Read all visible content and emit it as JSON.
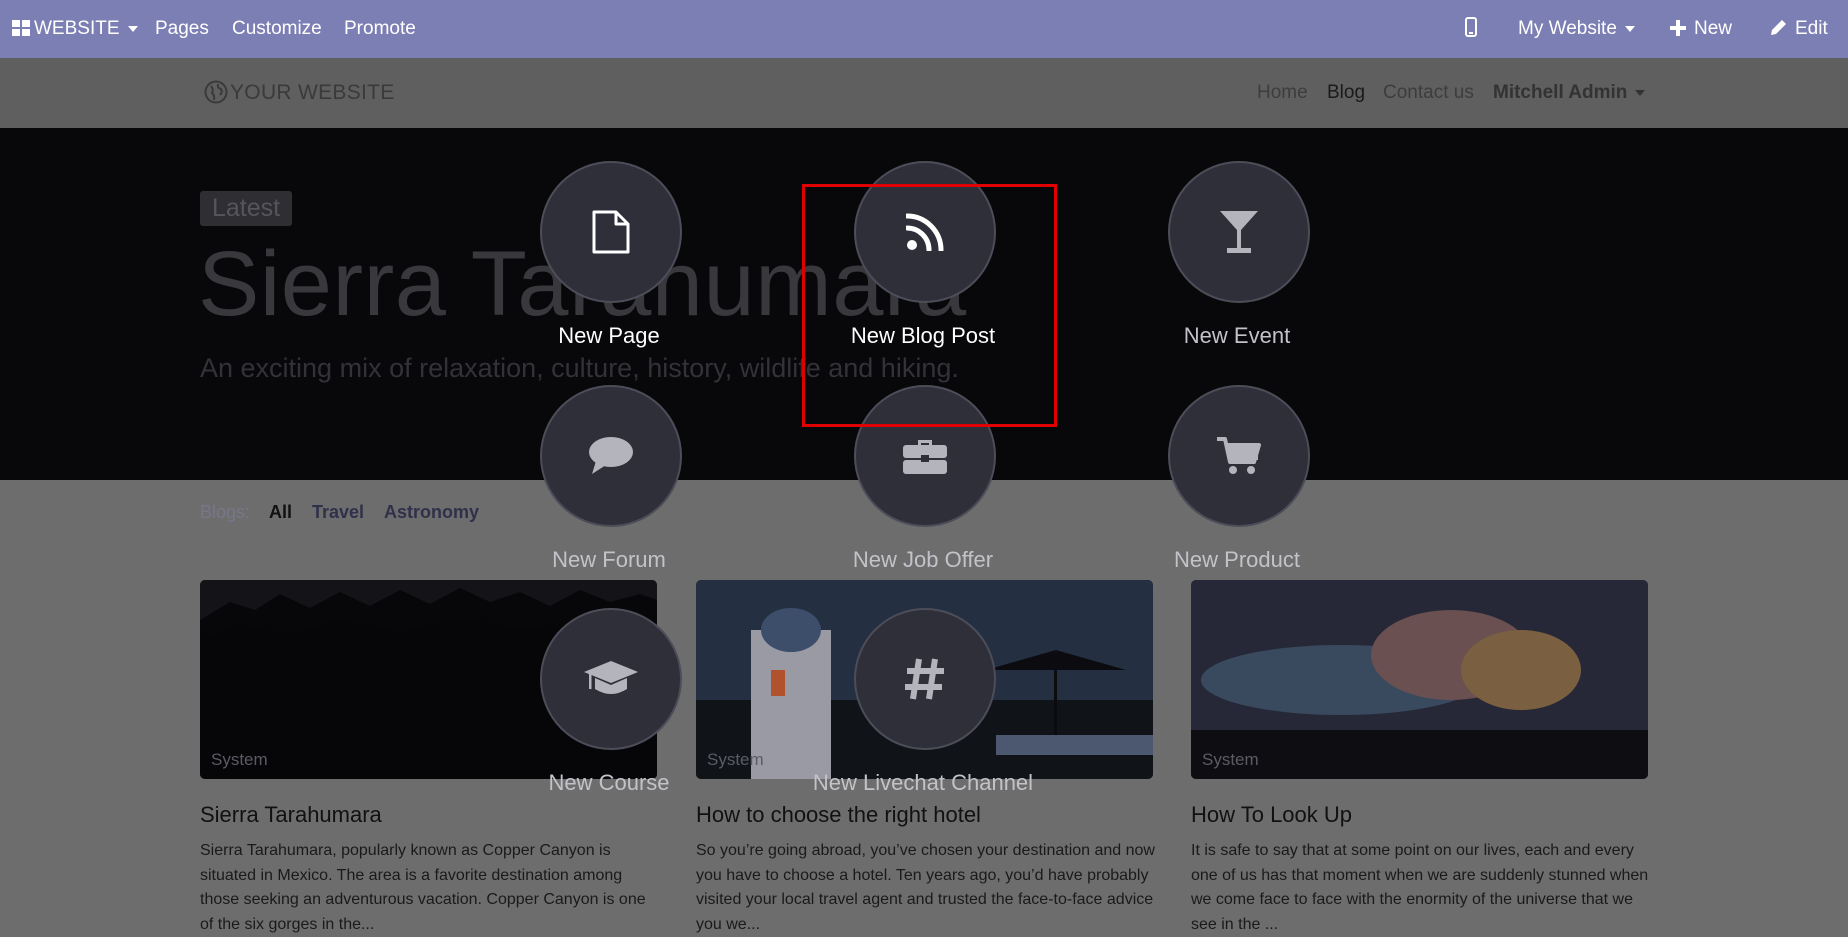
{
  "topbar": {
    "app_menu": "WEBSITE",
    "pages": "Pages",
    "customize": "Customize",
    "promote": "Promote",
    "website_switcher": "My Website",
    "new": "New",
    "edit": "Edit",
    "bg_color": "#7c7fb4"
  },
  "site_header": {
    "logo": "YOUR WEBSITE",
    "nav": {
      "home": "Home",
      "blog": "Blog",
      "contact": "Contact us",
      "user": "Mitchell Admin"
    }
  },
  "hero": {
    "badge": "Latest",
    "title": "Sierra Tarahumara",
    "subtitle": "An exciting mix of relaxation, culture, history, wildlife and hiking."
  },
  "filters": {
    "label": "Blogs:",
    "all": "All",
    "travel": "Travel",
    "astronomy": "Astronomy"
  },
  "posts": [
    {
      "author": "System",
      "title": "Sierra Tarahumara",
      "excerpt": "Sierra Tarahumara, popularly known as Copper Canyon is situated in Mexico. The area is a favorite destination among those seeking an adventurous vacation. Copper Canyon is one of the six gorges in the..."
    },
    {
      "author": "System",
      "title": "How to choose the right hotel",
      "excerpt": "So you’re going abroad, you’ve chosen your destination and now you have to choose a hotel. Ten years ago, you’d have probably visited your local travel agent and trusted the face-to-face advice you we..."
    },
    {
      "author": "System",
      "title": "How To Look Up",
      "excerpt": "It is safe to say that at some point on our lives, each and every one of us has that moment when we are suddenly stunned when we come face to face with the enormity of the universe that we see in the ..."
    }
  ],
  "new_content_dialog": {
    "options": [
      {
        "label": "New Page",
        "icon": "file-icon"
      },
      {
        "label": "New Blog Post",
        "icon": "rss-icon",
        "highlighted": true
      },
      {
        "label": "New Event",
        "icon": "glass-icon"
      },
      {
        "label": "New Forum",
        "icon": "comment-icon"
      },
      {
        "label": "New Job Offer",
        "icon": "briefcase-icon"
      },
      {
        "label": "New Product",
        "icon": "shopping-cart-icon"
      },
      {
        "label": "New Course",
        "icon": "graduation-cap-icon"
      },
      {
        "label": "New Livechat Channel",
        "icon": "hashtag-icon"
      }
    ],
    "highlight_color": "#e00000"
  }
}
